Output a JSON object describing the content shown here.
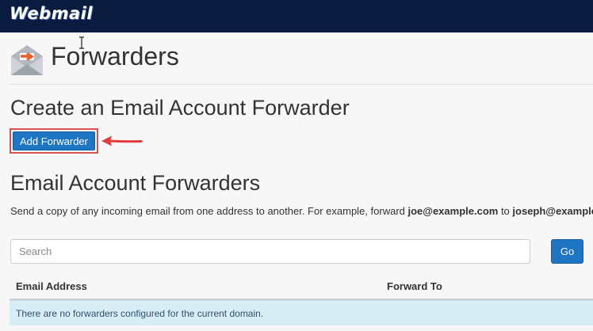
{
  "header": {
    "app_title": "Webmail"
  },
  "page": {
    "title": "Forwarders",
    "icon": "email-forward-icon"
  },
  "create_section": {
    "heading": "Create an Email Account Forwarder",
    "add_button_label": "Add Forwarder"
  },
  "list_section": {
    "heading": "Email Account Forwarders",
    "description_prefix": "Send a copy of any incoming email from one address to another. For example, forward ",
    "description_example_from": "joe@example.com",
    "description_to": " to ",
    "description_example_to": "joseph@example.com"
  },
  "search": {
    "placeholder": "Search",
    "go_label": "Go"
  },
  "table": {
    "columns": [
      "Email Address",
      "Forward To"
    ],
    "empty_message": "There are no forwarders configured for the current domain."
  },
  "colors": {
    "topbar": "#091b3f",
    "primary_button": "#1d75c4",
    "highlight": "#d9534f",
    "info_row": "#d9edf7"
  }
}
